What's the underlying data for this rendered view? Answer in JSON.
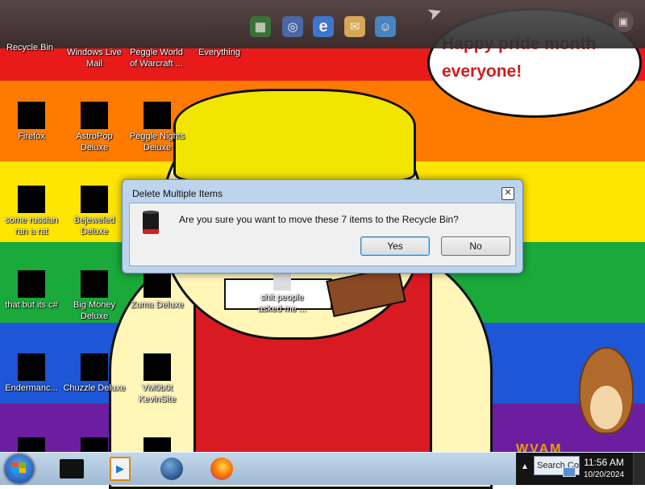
{
  "wallpaper": {
    "bands": [
      "#e81a1a",
      "#ff7b00",
      "#ffe600",
      "#1aa93b",
      "#1d56d6",
      "#6d1ea0"
    ],
    "speech_text": "Happy pride month everyone!",
    "bottom_scribble": "WVAM"
  },
  "top_dock": {
    "icons": [
      "spreadsheet-icon",
      "network-globe-icon",
      "internet-explorer-icon",
      "mail-icon",
      "people-icon"
    ],
    "case_icon": "briefcase-icon"
  },
  "desktop_icons": [
    {
      "label": "Recycle Bin"
    },
    {
      "label": "Windows Live Mail"
    },
    {
      "label": "Peggle World of Warcraft ..."
    },
    {
      "label": "Everything"
    },
    {
      "label": "Firefox"
    },
    {
      "label": "AstroPop Deluxe"
    },
    {
      "label": "Peggle Nights Deluxe"
    },
    {
      "label": "some russian ran a rat"
    },
    {
      "label": "Bejeweled Deluxe"
    },
    {
      "label": "that but its c#"
    },
    {
      "label": "Big Money Deluxe"
    },
    {
      "label": "Zuma Deluxe"
    },
    {
      "label": "shit people asked me ..."
    },
    {
      "label": "Endermanc..."
    },
    {
      "label": "Chuzzle Deluxe"
    },
    {
      "label": "VM0b0t KevinSite"
    }
  ],
  "dialog": {
    "title": "Delete Multiple Items",
    "message": "Are you sure you want to move these 7 items to the Recycle Bin?",
    "yes_label": "Yes",
    "no_label": "No",
    "close_glyph": "✕"
  },
  "taskbar": {
    "apps": [
      "command-prompt-icon",
      "media-player-icon",
      "globe-icon",
      "firefox-icon"
    ],
    "tray_arrow": "▲",
    "search_placeholder": "Search Co",
    "time": "11:56 AM",
    "date": "10/20/2024"
  }
}
